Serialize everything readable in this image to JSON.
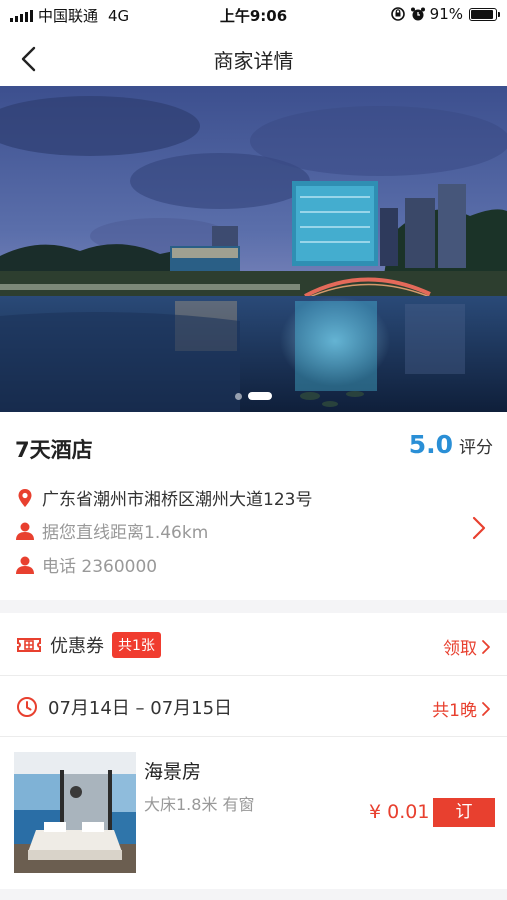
{
  "status_bar": {
    "carrier": "中国联通",
    "network": "4G",
    "time": "上午9:06",
    "battery_percent": "91%",
    "battery_level": 0.91
  },
  "nav": {
    "title": "商家详情",
    "back_icon": "chevron-left-icon"
  },
  "hero": {
    "slide_count": 2,
    "active_slide": 2
  },
  "hotel": {
    "name": "7天酒店",
    "rating_score": "5.0",
    "rating_unit": "评分",
    "address": "广东省潮州市湘桥区潮州大道123号",
    "distance": "据您直线距离1.46km",
    "phone": "电话 2360000"
  },
  "coupon": {
    "label": "优惠券",
    "badge": "共1张",
    "action": "领取"
  },
  "dates": {
    "range": "07月14日 – 07月15日",
    "nights": "共1晚"
  },
  "room": {
    "name": "海景房",
    "desc": "大床1.8米  有窗",
    "price": "¥ 0.01",
    "book_label": "订"
  },
  "colors": {
    "accent_red": "#e8402f",
    "rating_blue": "#2a8fd6",
    "separator": "#f4f4f6"
  }
}
